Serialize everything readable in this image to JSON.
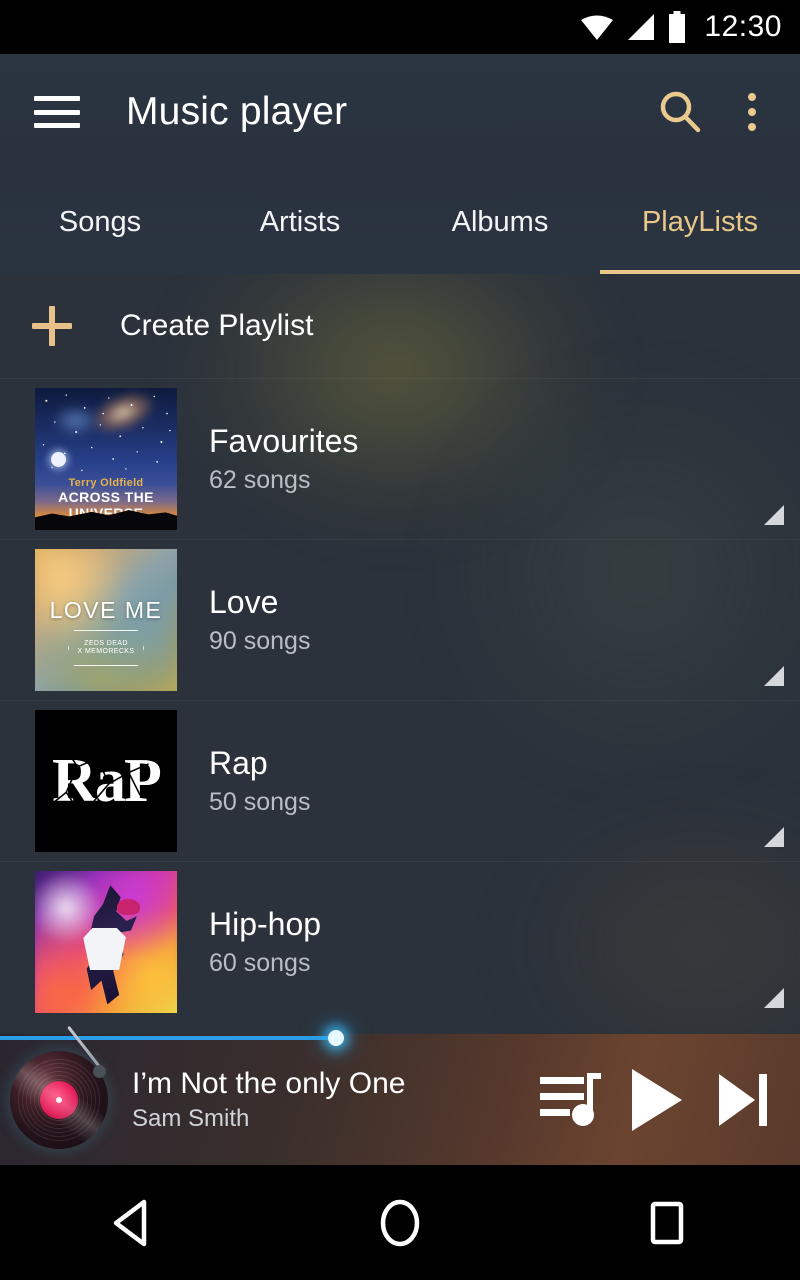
{
  "status_bar": {
    "time": "12:30",
    "icons": [
      "wifi-icon",
      "signal-icon",
      "battery-icon"
    ]
  },
  "app_bar": {
    "menu_icon": "hamburger-menu-icon",
    "title": "Music player",
    "search_icon": "search-icon",
    "overflow_icon": "overflow-menu-icon",
    "accent_color": "#e8c88a",
    "background_color": "#2a3340"
  },
  "tabs": [
    {
      "label": "Songs",
      "active": false
    },
    {
      "label": "Artists",
      "active": false
    },
    {
      "label": "Albums",
      "active": false
    },
    {
      "label": "PlayLists",
      "active": true
    }
  ],
  "content": {
    "create_playlist": {
      "label": "Create Playlist",
      "icon": "plus-icon"
    },
    "playlists": [
      {
        "name": "Favourites",
        "count": "62 songs",
        "art": {
          "id": "across-the-universe",
          "artist_text": "Terry Oldfield",
          "album_text": "ACROSS THE UNIVERSE"
        }
      },
      {
        "name": "Love",
        "count": "90 songs",
        "art": {
          "id": "love-me",
          "title_text": "LOVE ME",
          "badge_line1": "ZEDS DEAD",
          "badge_line2": "X MEMORECKS"
        }
      },
      {
        "name": "Rap",
        "count": "50 songs",
        "art": {
          "id": "rap-shattered",
          "title_text": "RaP"
        }
      },
      {
        "name": "Hip-hop",
        "count": "60 songs",
        "art": {
          "id": "hip-hop-dancer"
        }
      }
    ]
  },
  "now_playing": {
    "artwork_icon": "vinyl-record-icon",
    "title": "I’m Not the only One",
    "artist": "Sam Smith",
    "progress_percent": 42,
    "progress_color": "#2b9ee8",
    "queue_icon": "queue-music-icon",
    "play_icon": "play-icon",
    "next_icon": "skip-next-icon"
  },
  "nav_bar": {
    "back_icon": "back-triangle-icon",
    "home_icon": "home-circle-icon",
    "recents_icon": "recents-square-icon"
  }
}
